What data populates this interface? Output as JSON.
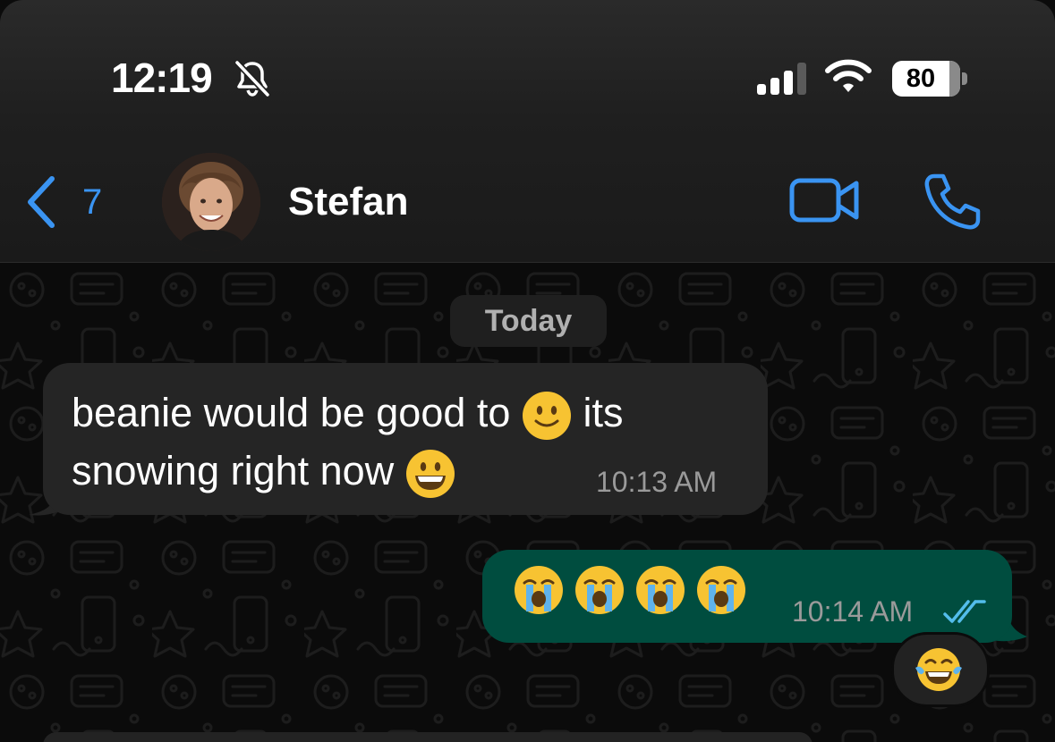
{
  "status_bar": {
    "time": "12:19",
    "battery": "80",
    "icons": [
      "bell-slash-icon",
      "cellular-signal-icon",
      "wifi-icon",
      "battery-icon"
    ]
  },
  "header": {
    "back_count": "7",
    "contact_name": "Stefan",
    "icons": [
      "chevron-left-icon",
      "video-camera-icon",
      "phone-icon"
    ]
  },
  "chat": {
    "day_separator": "Today",
    "messages": [
      {
        "direction": "incoming",
        "line1": "beanie would be good to",
        "line1_emoji": "slightly-smiling-face",
        "line1_end": "its",
        "line2": "snowing right now",
        "line2_emoji": "grinning-face",
        "time": "10:13 AM"
      },
      {
        "direction": "outgoing",
        "emojis": [
          "loudly-crying-face",
          "loudly-crying-face",
          "loudly-crying-face",
          "loudly-crying-face"
        ],
        "time": "10:14 AM",
        "status": "read",
        "reaction": "face-with-tears-of-joy"
      }
    ]
  },
  "colors": {
    "accent": "#3a94f2",
    "incoming_bubble": "#252525",
    "outgoing_bubble": "#004d3f",
    "read_ticks": "#53bdeb"
  }
}
